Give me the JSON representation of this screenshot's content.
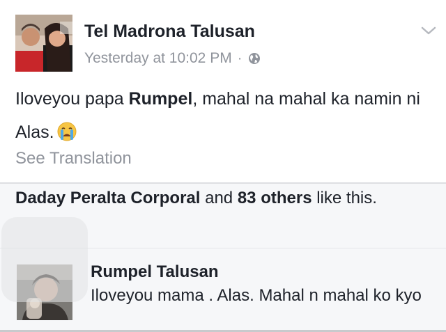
{
  "post": {
    "author": "Tel Madrona Talusan",
    "timestamp": "Yesterday at 10:02 PM",
    "separator": "·",
    "privacy_icon": "globe-icon",
    "menu_icon": "chevron-down-icon",
    "avatar": "profile-photo",
    "text_before": "Iloveyou papa ",
    "text_bold": "Rumpel",
    "text_after": ", mahal na mahal ka namin ni Alas.",
    "emoji": "loudly-crying-face-emoji",
    "see_translation": "See Translation"
  },
  "likes": {
    "name": "Daday Peralta Corporal",
    "connector": " and ",
    "others": "83 others",
    "suffix": " like this."
  },
  "comment": {
    "author": "Rumpel Talusan",
    "text": "Iloveyou mama . Alas. Mahal n mahal ko kyo",
    "avatar": "profile-photo"
  },
  "colors": {
    "text_primary": "#1d2129",
    "text_secondary": "#90949c",
    "background": "#ffffff",
    "section_background": "#f6f7f9",
    "divider": "#dddfe2"
  }
}
